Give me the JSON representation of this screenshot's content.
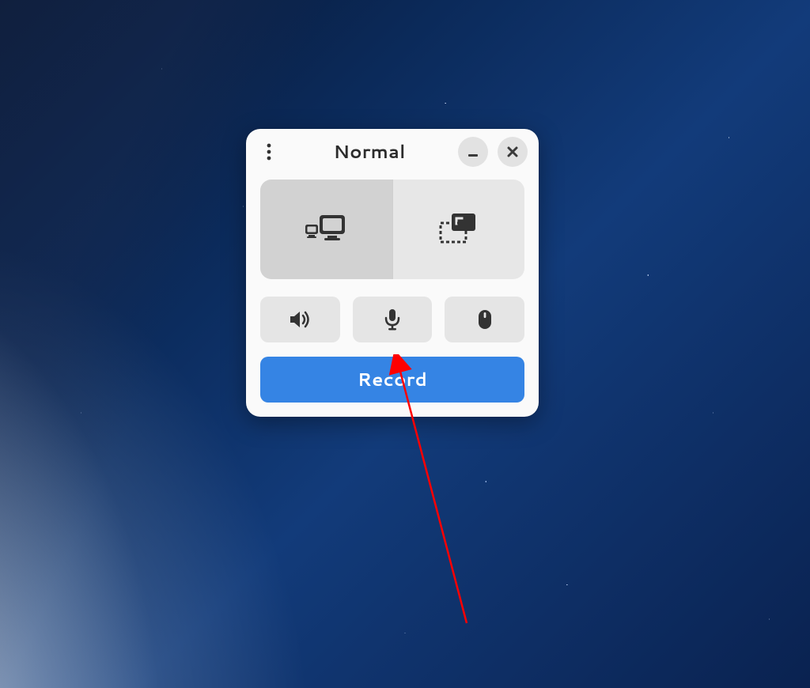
{
  "window": {
    "title": "Normal",
    "menu_icon": "kebab",
    "minimize_icon": "minimize",
    "close_icon": "close"
  },
  "capture_modes": {
    "screen": {
      "icon": "screen-capture",
      "selected": true
    },
    "selection": {
      "icon": "selection-capture",
      "selected": false
    }
  },
  "options": {
    "sound": {
      "icon": "speaker"
    },
    "mic": {
      "icon": "microphone"
    },
    "pointer": {
      "icon": "mouse"
    }
  },
  "actions": {
    "record_label": "Record"
  },
  "colors": {
    "accent": "#3584e4",
    "annotation": "#ff0000"
  }
}
